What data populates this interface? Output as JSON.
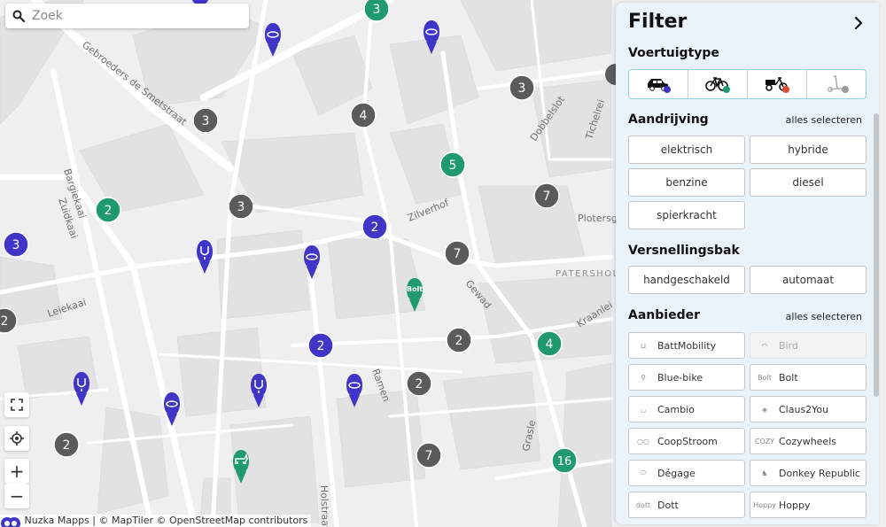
{
  "search": {
    "placeholder": "Zoek"
  },
  "map": {
    "streets": [
      "Gebroeders de Smetstraat",
      "Bargiekaai",
      "Zuidkaai",
      "Leiekaai",
      "Zilverhof",
      "Gewad",
      "Ramen",
      "Holstraat",
      "Dobbelslot",
      "Tichelrei",
      "Kraanlei",
      "Grasle",
      "Plotersgr"
    ],
    "district": "PATERSHOL",
    "clusters": [
      {
        "name": "cluster-grey",
        "label": "3"
      },
      {
        "name": "cluster-grey",
        "label": "4"
      },
      {
        "name": "cluster-grey",
        "label": "3"
      },
      {
        "name": "cluster-grey",
        "label": "3"
      },
      {
        "name": "cluster-grey",
        "label": "7"
      },
      {
        "name": "cluster-grey",
        "label": "7"
      },
      {
        "name": "cluster-grey",
        "label": "2"
      },
      {
        "name": "cluster-grey",
        "label": "2"
      },
      {
        "name": "cluster-grey",
        "label": "2"
      },
      {
        "name": "cluster-grey",
        "label": "7"
      },
      {
        "name": "cluster-grey",
        "label": "2"
      },
      {
        "name": "cluster-green",
        "label": "3"
      },
      {
        "name": "cluster-green",
        "label": "5"
      },
      {
        "name": "cluster-green",
        "label": "2"
      },
      {
        "name": "cluster-green",
        "label": "4"
      },
      {
        "name": "cluster-green",
        "label": "16"
      },
      {
        "name": "cluster-purple",
        "label": "2"
      },
      {
        "name": "cluster-purple",
        "label": "3"
      },
      {
        "name": "cluster-purple",
        "label": "2"
      }
    ],
    "pin_bolt_label": "Bolt",
    "colors": {
      "grey": "#5b5b5b",
      "green": "#1e9a6d",
      "purple": "#3f35c6"
    }
  },
  "controls": {
    "fullscreen_icon": "fullscreen-icon",
    "locate_icon": "locate-icon",
    "zoom_in": "+",
    "zoom_out": "−"
  },
  "attribution": "Nuzka Mapps | © MapTiler © OpenStreetMap contributors",
  "filter": {
    "title": "Filter",
    "vehicle_type": {
      "title": "Voertuigtype",
      "options": [
        {
          "icon": "car-icon",
          "color": "#3f35c6"
        },
        {
          "icon": "bike-icon",
          "color": "#1e9a6d"
        },
        {
          "icon": "cargo-bike-icon",
          "color": "#e24a2a"
        },
        {
          "icon": "scooter-icon",
          "color": "#9a9a9a"
        }
      ]
    },
    "drive": {
      "title": "Aandrijving",
      "select_all": "alles selecteren",
      "options": [
        "elektrisch",
        "hybride",
        "benzine",
        "diesel",
        "spierkracht"
      ]
    },
    "gearbox": {
      "title": "Versnellingsbak",
      "options": [
        "handgeschakeld",
        "automaat"
      ]
    },
    "provider": {
      "title": "Aanbieder",
      "select_all": "alles selecteren",
      "items": [
        {
          "label": "BattMobility",
          "logo": "battmobility-logo",
          "mark": ""
        },
        {
          "label": "Bird",
          "logo": "bird-logo",
          "mark": "",
          "disabled": true
        },
        {
          "label": "Blue-bike",
          "logo": "bluebike-logo",
          "mark": ""
        },
        {
          "label": "Bolt",
          "logo": "bolt-logo",
          "mark": "Bolt"
        },
        {
          "label": "Cambio",
          "logo": "cambio-logo",
          "mark": ""
        },
        {
          "label": "Claus2You",
          "logo": "claus2you-logo",
          "mark": ""
        },
        {
          "label": "CoopStroom",
          "logo": "coopstroom-logo",
          "mark": ""
        },
        {
          "label": "Cozywheels",
          "logo": "cozywheels-logo",
          "mark": "COZY"
        },
        {
          "label": "Dégage",
          "logo": "degage-logo",
          "mark": ""
        },
        {
          "label": "Donkey Republic",
          "logo": "donkey-logo",
          "mark": ""
        },
        {
          "label": "Dott",
          "logo": "dott-logo",
          "mark": "dott"
        },
        {
          "label": "Hoppy",
          "logo": "hoppy-logo",
          "mark": "Hoppy"
        }
      ]
    }
  }
}
